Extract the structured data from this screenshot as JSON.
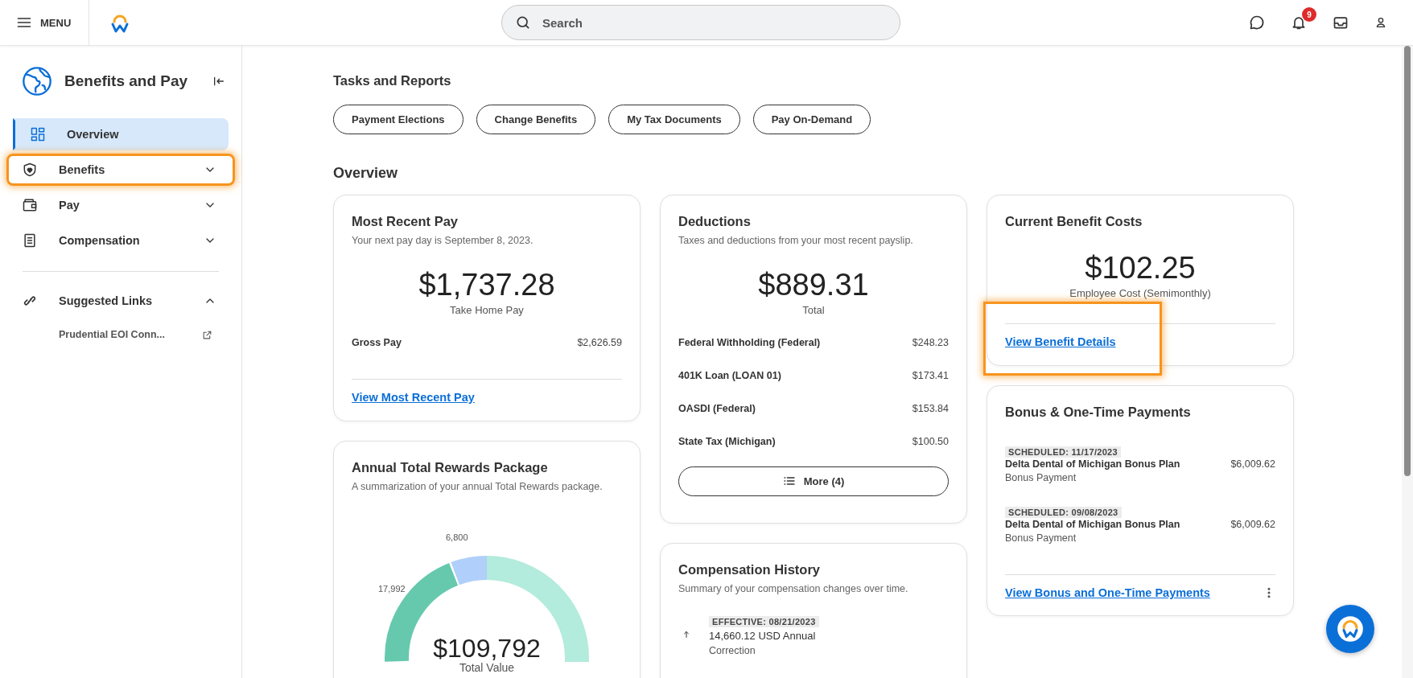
{
  "topbar": {
    "menu_label": "MENU",
    "search_placeholder": "Search",
    "notification_count": "9"
  },
  "sidebar": {
    "title": "Benefits and Pay",
    "items": [
      {
        "label": "Overview",
        "kind": "link",
        "selected": true,
        "highlighted": false
      },
      {
        "label": "Benefits",
        "kind": "group",
        "selected": false,
        "expanded": false,
        "highlighted": true
      },
      {
        "label": "Pay",
        "kind": "group",
        "selected": false,
        "expanded": false,
        "highlighted": false
      },
      {
        "label": "Compensation",
        "kind": "group",
        "selected": false,
        "expanded": false,
        "highlighted": false
      }
    ],
    "links_section": {
      "label": "Suggested Links",
      "expanded": true,
      "links": [
        {
          "label": "Prudential EOI Conn..."
        }
      ]
    }
  },
  "tasks": {
    "title": "Tasks and Reports",
    "buttons": [
      "Payment Elections",
      "Change Benefits",
      "My Tax Documents",
      "Pay On-Demand"
    ]
  },
  "overview_title": "Overview",
  "columns": [
    [
      {
        "kind": "amount",
        "title": "Most Recent Pay",
        "subtitle": "Your next pay day is September 8, 2023.",
        "amount": "$1,737.28",
        "amount_label": "Take Home Pay",
        "rows": [
          {
            "label": "Gross Pay",
            "value": "$2,626.59"
          }
        ],
        "link": "View Most Recent Pay",
        "link_highlighted": false
      },
      {
        "kind": "rewards",
        "title": "Annual Total Rewards Package",
        "subtitle": "A summarization of your annual Total Rewards package.",
        "slice_labels": [
          "6,800",
          "17,992"
        ],
        "total": "$109,792",
        "total_label": "Total Value"
      }
    ],
    [
      {
        "kind": "amount",
        "title": "Deductions",
        "subtitle": "Taxes and deductions from your most recent payslip.",
        "amount": "$889.31",
        "amount_label": "Total",
        "rows": [
          {
            "label": "Federal Withholding (Federal)",
            "value": "$248.23"
          },
          {
            "label": "401K Loan (LOAN 01)",
            "value": "$173.41"
          },
          {
            "label": "OASDI (Federal)",
            "value": "$153.84"
          },
          {
            "label": "State Tax (Michigan)",
            "value": "$100.50"
          }
        ],
        "more_button": "More (4)"
      },
      {
        "kind": "history",
        "title": "Compensation History",
        "subtitle": "Summary of your compensation changes over time.",
        "entries": [
          {
            "badge": "EFFECTIVE: 08/21/2023",
            "value": "14,660.12 USD Annual",
            "note": "Correction"
          }
        ]
      }
    ],
    [
      {
        "kind": "amount",
        "title": "Current Benefit Costs",
        "amount": "$102.25",
        "amount_label": "Employee Cost (Semimonthly)",
        "link": "View Benefit Details",
        "link_highlighted": true
      },
      {
        "kind": "payments",
        "title": "Bonus & One-Time Payments",
        "payments": [
          {
            "badge": "SCHEDULED: 11/17/2023",
            "name": "Delta Dental of Michigan Bonus Plan",
            "type": "Bonus Payment",
            "amount": "$6,009.62"
          },
          {
            "badge": "SCHEDULED: 09/08/2023",
            "name": "Delta Dental of Michigan Bonus Plan",
            "type": "Bonus Payment",
            "amount": "$6,009.62"
          }
        ],
        "link": "View Bonus and One-Time Payments"
      }
    ]
  ]
}
